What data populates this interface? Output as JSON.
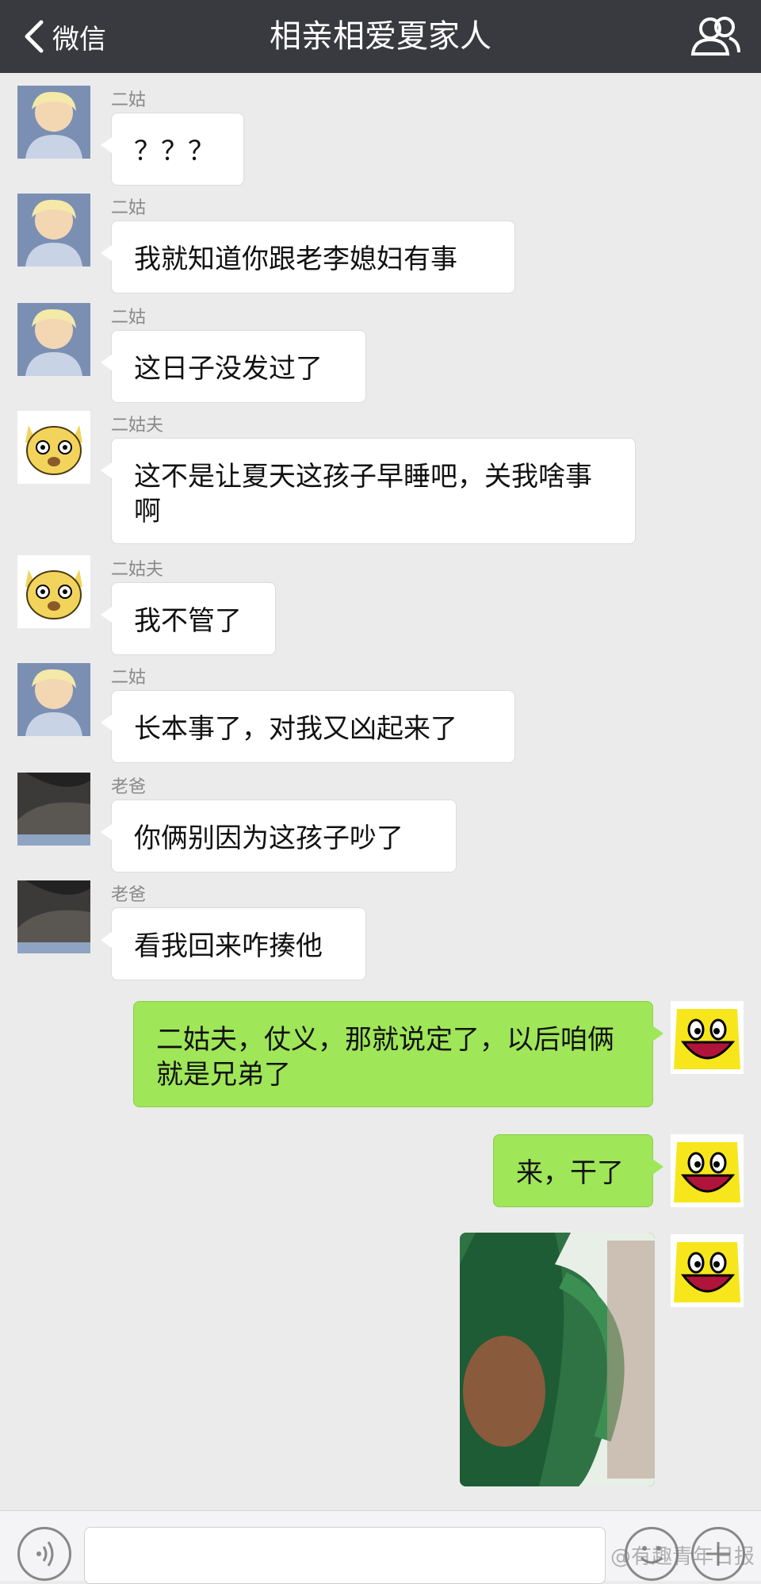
{
  "header": {
    "back_label": "微信",
    "title": "相亲相爱夏家人"
  },
  "messages": [
    {
      "sender": "二姑",
      "text": "？？？"
    },
    {
      "sender": "二姑",
      "text": "我就知道你跟老李媳妇有事"
    },
    {
      "sender": "二姑",
      "text": "这日子没发过了"
    },
    {
      "sender": "二姑夫",
      "text": "这不是让夏天这孩子早睡吧，关我啥事啊"
    },
    {
      "sender": "二姑夫",
      "text": "我不管了"
    },
    {
      "sender": "二姑",
      "text": "长本事了，对我又凶起来了"
    },
    {
      "sender": "老爸",
      "text": "你俩别因为这孩子吵了"
    },
    {
      "sender": "老爸",
      "text": "看我回来咋揍他"
    },
    {
      "sender": "",
      "text": "二姑夫，仗义，那就说定了，以后咱俩就是兄弟了"
    },
    {
      "sender": "",
      "text": "来，干了"
    }
  ],
  "watermark": "@有趣青年日报",
  "colors": {
    "header_bg": "#393a3f",
    "chat_bg": "#ebebeb",
    "outgoing_bubble": "#9fe658",
    "incoming_bubble": "#ffffff"
  }
}
